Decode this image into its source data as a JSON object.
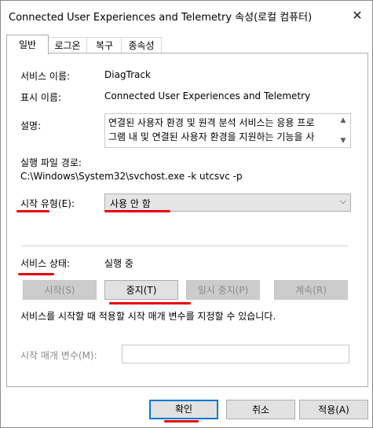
{
  "window": {
    "title": "Connected User Experiences and Telemetry 속성(로컬 컴퓨터)"
  },
  "icons": {
    "close": "close-icon",
    "scroll_up": "chevron-up-icon",
    "scroll_down": "chevron-down-icon",
    "dropdown": "chevron-down-icon"
  },
  "tabs": [
    {
      "label": "일반",
      "active": true
    },
    {
      "label": "로그온"
    },
    {
      "label": "복구"
    },
    {
      "label": "종속성"
    }
  ],
  "general": {
    "service_name_label": "서비스 이름:",
    "service_name_value": "DiagTrack",
    "display_name_label": "표시 이름:",
    "display_name_value": "Connected User Experiences and Telemetry",
    "description_label": "설명:",
    "description_line1": "연결된 사용자 환경 및 원격 분석 서비스는 응용 프로",
    "description_line2": "그램 내 및 연결된 사용자 환경을 지원하는 기능을 사",
    "exe_path_label": "실행 파일 경로:",
    "exe_path_value": "C:\\Windows\\System32\\svchost.exe -k utcsvc -p",
    "startup_type_label": "시작 유형(E):",
    "startup_type_value": "사용 안 함",
    "service_status_label": "서비스 상태:",
    "service_status_value": "실행 중",
    "start_button": "시작(S)",
    "stop_button": "중지(T)",
    "pause_button": "일시 중지(P)",
    "resume_button": "계속(R)",
    "start_params_hint": "서비스를 시작할 때 적용할 시작 매개 변수를 지정할 수 있습니다.",
    "start_params_label": "시작 매개 변수(M):",
    "start_params_value": ""
  },
  "footer": {
    "ok_button": "확인",
    "cancel_button": "취소",
    "apply_button": "적용(A)"
  },
  "colors": {
    "highlight_mark": "#e8000b",
    "default_button_border": "#0078d7",
    "disabled_text": "#8a8a8a"
  }
}
